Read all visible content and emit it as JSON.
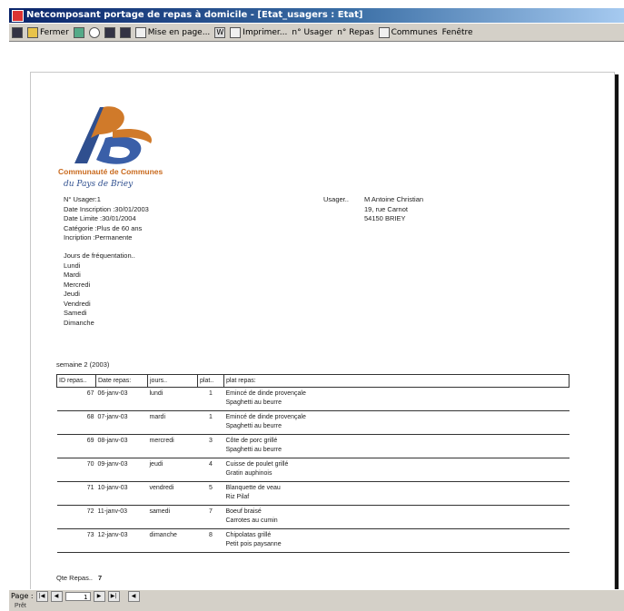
{
  "window": {
    "title": "Netcomposant portage de repas à domicile - [Etat_usagers : Etat]"
  },
  "toolbar": {
    "fermer_label": "Fermer",
    "mise_en_page_label": "Mise en page...",
    "imprimer_label": "Imprimer...",
    "n_usager_label": "n° Usager",
    "n_repas_label": "n° Repas",
    "communes_label": "Communes",
    "fenetre_label": "Fenêtre"
  },
  "logo": {
    "line1": "Communauté de Communes",
    "line2": "du Pays de Briey"
  },
  "usager": {
    "numero": "N° Usager:1",
    "date_inscription": "Date Inscription :30/01/2003",
    "date_limite": "Date Limite :30/01/2004",
    "categorie": "Catégorie :Plus de 60 ans",
    "incription": "Incription :Permanente",
    "label": "Usager..",
    "nom": "M Antoine Christian",
    "adresse": "19, rue Carnot",
    "ville": "54150 BRIEY"
  },
  "frequentation": {
    "title": "Jours de fréquentation..",
    "jours": [
      "Lundi",
      "Mardi",
      "Mercredi",
      "Jeudi",
      "Vendredi",
      "Samedi",
      "Dimanche"
    ]
  },
  "semaine": "semaine 2 (2003)",
  "table": {
    "headers": [
      "ID repas..",
      "Date repas:",
      "jours..",
      "plat..",
      "plat repas:"
    ],
    "rows": [
      {
        "id": "67",
        "date": "06-janv-03",
        "jour": "lundi",
        "plat": "1",
        "plat1": "Emincé de dinde provençale",
        "plat2": "Spaghetti au beurre"
      },
      {
        "id": "68",
        "date": "07-janv-03",
        "jour": "mardi",
        "plat": "1",
        "plat1": "Emincé de dinde provençale",
        "plat2": "Spaghetti au beurre"
      },
      {
        "id": "69",
        "date": "08-janv-03",
        "jour": "mercredi",
        "plat": "3",
        "plat1": "Côte de porc grillé",
        "plat2": "Spaghetti au beurre"
      },
      {
        "id": "70",
        "date": "09-janv-03",
        "jour": "jeudi",
        "plat": "4",
        "plat1": "Cuisse de poulet grillé",
        "plat2": "Gratin auphinois"
      },
      {
        "id": "71",
        "date": "10-janv-03",
        "jour": "vendredi",
        "plat": "5",
        "plat1": "Blanquette de veau",
        "plat2": "Riz Pilaf"
      },
      {
        "id": "72",
        "date": "11-janv-03",
        "jour": "samedi",
        "plat": "7",
        "plat1": "Boeuf braisé",
        "plat2": "Carrotes au cumin"
      },
      {
        "id": "73",
        "date": "12-janv-03",
        "jour": "dimanche",
        "plat": "8",
        "plat1": "Chipolatas grillé",
        "plat2": "Petit pois paysanne"
      }
    ]
  },
  "total": {
    "label": "Qte Repas..",
    "value": "7"
  },
  "statusbar": {
    "page_label": "Page :",
    "page_value": "1",
    "prefix": "Prêt"
  }
}
